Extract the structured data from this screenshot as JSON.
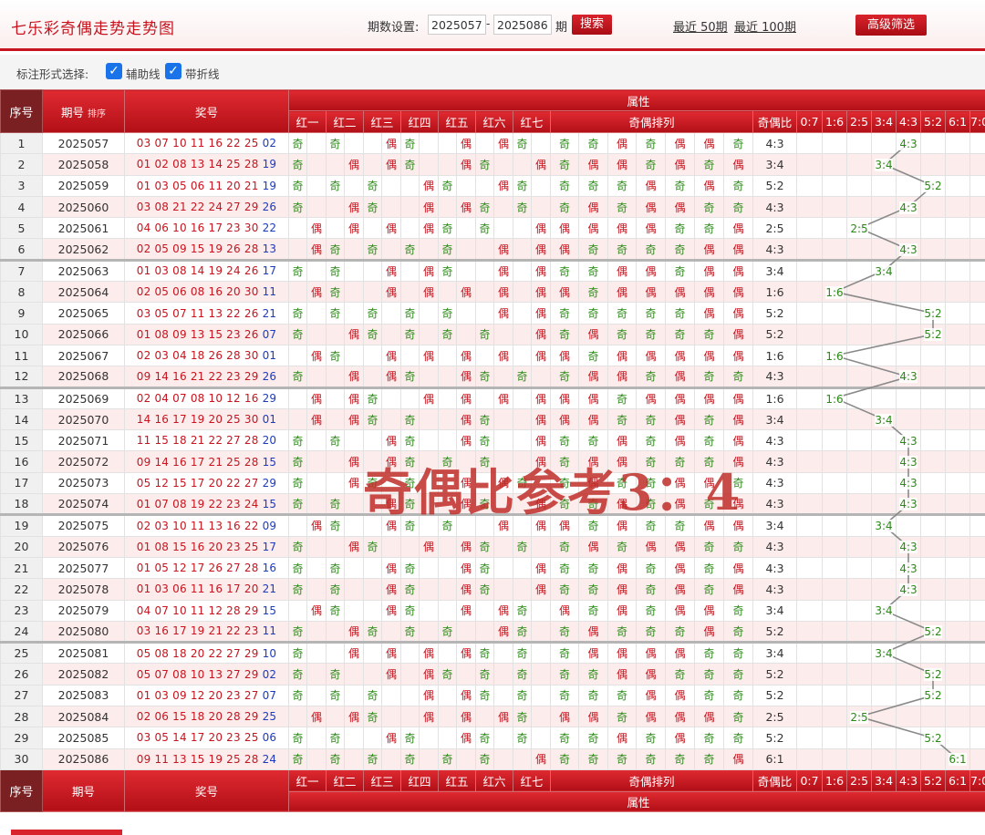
{
  "header": {
    "title": "七乐彩奇偶走势走势图",
    "period_label": "期数设置:",
    "period_from": "2025057",
    "period_to": "2025086",
    "period_unit": "期",
    "search_label": "搜索",
    "recent50": "最近 50期",
    "recent100": "最近 100期",
    "advanced_label": "高级筛选"
  },
  "options": {
    "label": "标注形式选择:",
    "aux_line": "辅助线",
    "polyline": "带折线"
  },
  "table": {
    "h_seq": "序号",
    "h_issue": "期号",
    "h_sort": "排序",
    "h_nums": "奖号",
    "h_attr": "属性",
    "h_pos": [
      "红一",
      "红二",
      "红三",
      "红四",
      "红五",
      "红六",
      "红七"
    ],
    "h_arr": "奇偶排列",
    "h_ratio": "奇偶比",
    "h_ratios": [
      "0:7",
      "1:6",
      "2:5",
      "3:4",
      "4:3",
      "5:2",
      "6:1",
      "7:0"
    ],
    "rows": [
      {
        "seq": "1",
        "issue": "2025057",
        "nums": "03 07 10 11 16 22 25",
        "blue": "02",
        "ratio": "4:3",
        "r": 4
      },
      {
        "seq": "2",
        "issue": "2025058",
        "nums": "01 02 08 13 14 25 28",
        "blue": "19",
        "ratio": "3:4",
        "r": 3
      },
      {
        "seq": "3",
        "issue": "2025059",
        "nums": "01 03 05 06 11 20 21",
        "blue": "19",
        "ratio": "5:2",
        "r": 5
      },
      {
        "seq": "4",
        "issue": "2025060",
        "nums": "03 08 21 22 24 27 29",
        "blue": "26",
        "ratio": "4:3",
        "r": 4
      },
      {
        "seq": "5",
        "issue": "2025061",
        "nums": "04 06 10 16 17 23 30",
        "blue": "22",
        "ratio": "2:5",
        "r": 2
      },
      {
        "seq": "6",
        "issue": "2025062",
        "nums": "02 05 09 15 19 26 28",
        "blue": "13",
        "ratio": "4:3",
        "r": 4
      },
      {
        "seq": "7",
        "issue": "2025063",
        "nums": "01 03 08 14 19 24 26",
        "blue": "17",
        "ratio": "3:4",
        "r": 3
      },
      {
        "seq": "8",
        "issue": "2025064",
        "nums": "02 05 06 08 16 20 30",
        "blue": "11",
        "ratio": "1:6",
        "r": 1
      },
      {
        "seq": "9",
        "issue": "2025065",
        "nums": "03 05 07 11 13 22 26",
        "blue": "21",
        "ratio": "5:2",
        "r": 5
      },
      {
        "seq": "10",
        "issue": "2025066",
        "nums": "01 08 09 13 15 23 26",
        "blue": "07",
        "ratio": "5:2",
        "r": 5
      },
      {
        "seq": "11",
        "issue": "2025067",
        "nums": "02 03 04 18 26 28 30",
        "blue": "01",
        "ratio": "1:6",
        "r": 1
      },
      {
        "seq": "12",
        "issue": "2025068",
        "nums": "09 14 16 21 22 23 29",
        "blue": "26",
        "ratio": "4:3",
        "r": 4
      },
      {
        "seq": "13",
        "issue": "2025069",
        "nums": "02 04 07 08 10 12 16",
        "blue": "29",
        "ratio": "1:6",
        "r": 1
      },
      {
        "seq": "14",
        "issue": "2025070",
        "nums": "14 16 17 19 20 25 30",
        "blue": "01",
        "ratio": "3:4",
        "r": 3
      },
      {
        "seq": "15",
        "issue": "2025071",
        "nums": "11 15 18 21 22 27 28",
        "blue": "20",
        "ratio": "4:3",
        "r": 4
      },
      {
        "seq": "16",
        "issue": "2025072",
        "nums": "09 14 16 17 21 25 28",
        "blue": "15",
        "ratio": "4:3",
        "r": 4
      },
      {
        "seq": "17",
        "issue": "2025073",
        "nums": "05 12 15 17 20 22 27",
        "blue": "29",
        "ratio": "4:3",
        "r": 4
      },
      {
        "seq": "18",
        "issue": "2025074",
        "nums": "01 07 08 19 22 23 24",
        "blue": "15",
        "ratio": "4:3",
        "r": 4
      },
      {
        "seq": "19",
        "issue": "2025075",
        "nums": "02 03 10 11 13 16 22",
        "blue": "09",
        "ratio": "3:4",
        "r": 3
      },
      {
        "seq": "20",
        "issue": "2025076",
        "nums": "01 08 15 16 20 23 25",
        "blue": "17",
        "ratio": "4:3",
        "r": 4
      },
      {
        "seq": "21",
        "issue": "2025077",
        "nums": "01 05 12 17 26 27 28",
        "blue": "16",
        "ratio": "4:3",
        "r": 4
      },
      {
        "seq": "22",
        "issue": "2025078",
        "nums": "01 03 06 11 16 17 20",
        "blue": "21",
        "ratio": "4:3",
        "r": 4
      },
      {
        "seq": "23",
        "issue": "2025079",
        "nums": "04 07 10 11 12 28 29",
        "blue": "15",
        "ratio": "3:4",
        "r": 3
      },
      {
        "seq": "24",
        "issue": "2025080",
        "nums": "03 16 17 19 21 22 23",
        "blue": "11",
        "ratio": "5:2",
        "r": 5
      },
      {
        "seq": "25",
        "issue": "2025081",
        "nums": "05 08 18 20 22 27 29",
        "blue": "10",
        "ratio": "3:4",
        "r": 3
      },
      {
        "seq": "26",
        "issue": "2025082",
        "nums": "05 07 08 10 13 27 29",
        "blue": "02",
        "ratio": "5:2",
        "r": 5
      },
      {
        "seq": "27",
        "issue": "2025083",
        "nums": "01 03 09 12 20 23 27",
        "blue": "07",
        "ratio": "5:2",
        "r": 5
      },
      {
        "seq": "28",
        "issue": "2025084",
        "nums": "02 06 15 18 20 28 29",
        "blue": "25",
        "ratio": "2:5",
        "r": 2
      },
      {
        "seq": "29",
        "issue": "2025085",
        "nums": "03 05 14 17 20 23 25",
        "blue": "06",
        "ratio": "5:2",
        "r": 5
      },
      {
        "seq": "30",
        "issue": "2025086",
        "nums": "09 11 13 15 19 25 28",
        "blue": "24",
        "ratio": "6:1",
        "r": 6
      }
    ]
  },
  "overlay_text": "奇偶比参考3：4",
  "colors": {
    "primary_red": "#c8141e",
    "odd_green": "#2b8a17",
    "blue_ball": "#1d3bbf",
    "row_pink": "#fdecec"
  }
}
